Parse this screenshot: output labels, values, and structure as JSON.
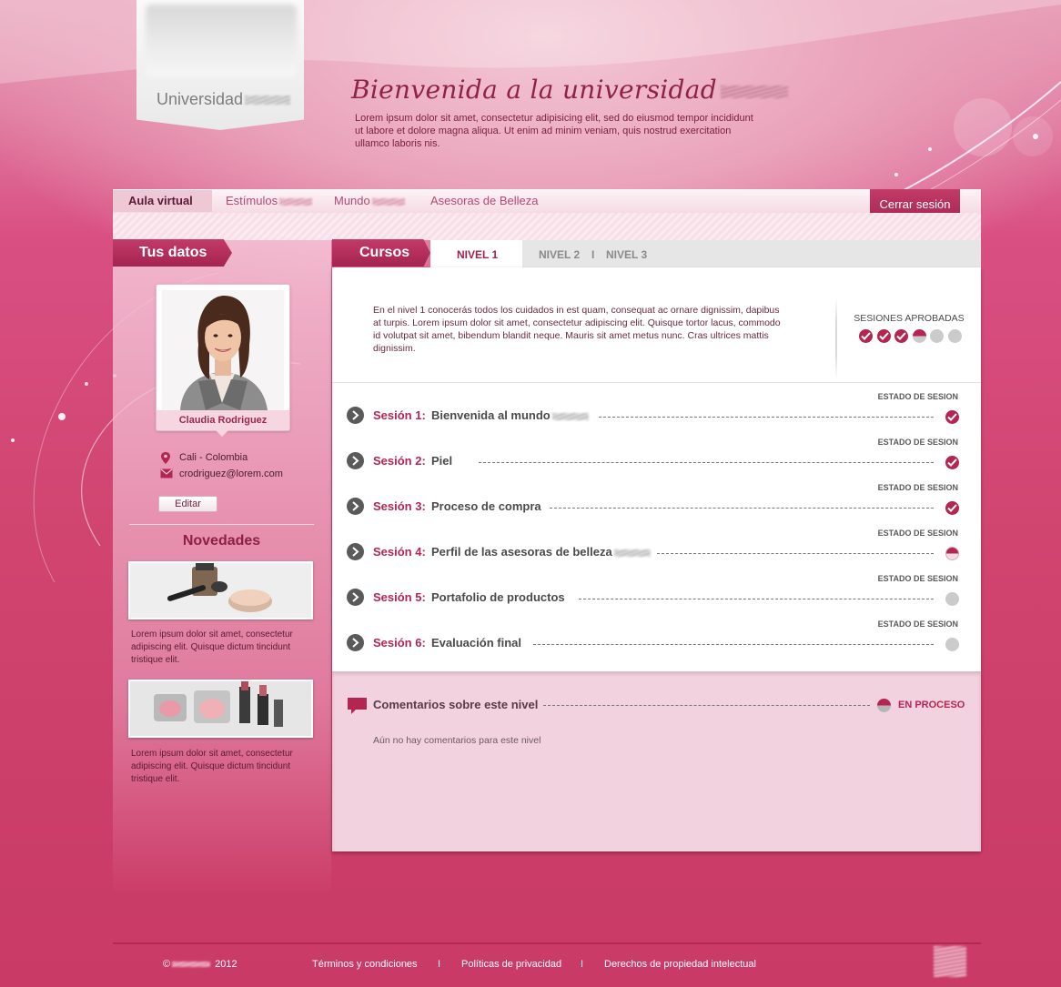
{
  "brand": {
    "logo_text": "Universidad"
  },
  "hero": {
    "title": "Bienvenida a la universidad",
    "text": "Lorem ipsum dolor sit amet, consectetur adipisicing elit, sed do eiusmod tempor incididunt ut labore et dolore magna aliqua. Ut enim ad minim veniam, quis nostrud exercitation ullamco laboris nis."
  },
  "nav": {
    "items": [
      {
        "label": "Aula virtual",
        "active": true
      },
      {
        "label": "Estímulos",
        "active": false
      },
      {
        "label": "Mundo",
        "active": false
      },
      {
        "label": "Asesoras de Belleza",
        "active": false
      }
    ],
    "logout": "Cerrar sesión"
  },
  "profile": {
    "section_title": "Tus datos",
    "name": "Claudia Rodriguez",
    "location": "Cali - Colombia",
    "email": "crodriguez@lorem.com",
    "edit_label": "Editar"
  },
  "news": {
    "title": "Novedades",
    "items": [
      {
        "text": "Lorem ipsum dolor sit amet, consectetur adipiscing elit. Quisque dictum tincidunt tristique elit."
      },
      {
        "text": "Lorem ipsum dolor sit amet, consectetur adipiscing elit. Quisque dictum tincidunt tristique elit."
      }
    ]
  },
  "courses": {
    "title": "Cursos",
    "tabs": [
      {
        "label": "NIVEL 1",
        "active": true
      },
      {
        "label": "NIVEL 2",
        "active": false
      },
      {
        "label": "NIVEL 3",
        "active": false
      }
    ],
    "tab_separator": "I",
    "intro": "En el nivel 1 conocerás  todos los cuidados  in est quam, consequat ac ornare dignissim, dapibus at turpis. Lorem ipsum dolor sit amet, consectetur adipiscing elit. Quisque tortor lacus, commodo id volutpat sit amet, bibendum blandit neque. Mauris sit amet metus nunc. Cras ultrices mattis dignissim.",
    "approved_label": "SESIONES APROBADAS",
    "approved_progress": [
      "done",
      "done",
      "done",
      "half",
      "none",
      "none"
    ],
    "status_label": "ESTADO DE SESION",
    "sessions": [
      {
        "number": "Sesión 1:",
        "name": "Bienvenida al mundo",
        "status": "done"
      },
      {
        "number": "Sesión 2:",
        "name": "Piel",
        "status": "done"
      },
      {
        "number": "Sesión 3:",
        "name": "Proceso de compra",
        "status": "done"
      },
      {
        "number": "Sesión 4:",
        "name": "Perfil de las asesoras de belleza",
        "status": "half"
      },
      {
        "number": "Sesión 5:",
        "name": "Portafolio de productos",
        "status": "none"
      },
      {
        "number": "Sesión 6:",
        "name": "Evaluación final",
        "status": "none"
      }
    ]
  },
  "comments": {
    "title": "Comentarios sobre este nivel",
    "status": "EN PROCESO",
    "empty_text": "Aún no hay comentarios para este nivel"
  },
  "footer": {
    "copyright_symbol": "©",
    "year": "2012",
    "links": [
      "Términos y condiciones",
      "Políticas de privacidad",
      "Derechos de propiedad intelectual"
    ],
    "separator": "I"
  },
  "colors": {
    "accent": "#b42552",
    "pending": "#cbcbcb"
  }
}
